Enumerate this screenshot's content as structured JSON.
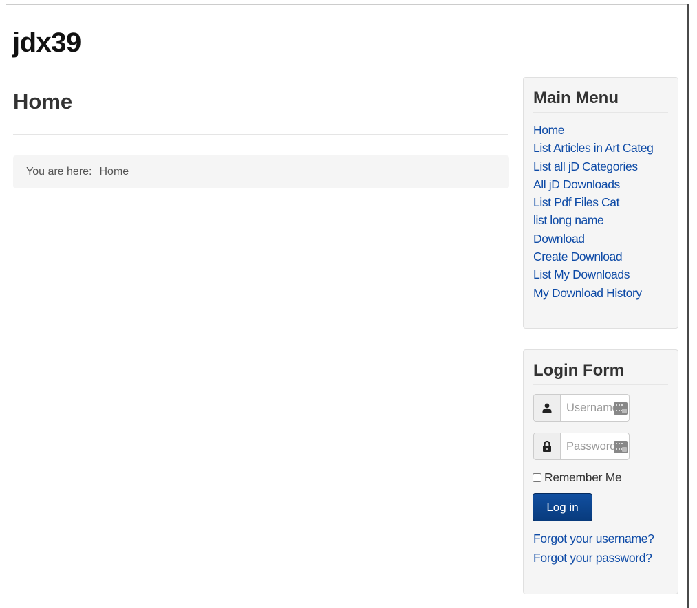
{
  "site": {
    "title": "jdx39"
  },
  "page": {
    "title": "Home"
  },
  "breadcrumb": {
    "prefix": "You are here:",
    "current": "Home"
  },
  "main_menu": {
    "title": "Main Menu",
    "items": [
      {
        "label": "Home"
      },
      {
        "label": "List Articles in Art Categ"
      },
      {
        "label": "List all jD Categories"
      },
      {
        "label": "All jD Downloads"
      },
      {
        "label": "List Pdf Files Cat"
      },
      {
        "label": "list long name"
      },
      {
        "label": "Download"
      },
      {
        "label": "Create Download"
      },
      {
        "label": "List My Downloads"
      },
      {
        "label": "My Download History"
      }
    ]
  },
  "login": {
    "title": "Login Form",
    "username_placeholder": "Username",
    "password_placeholder": "Password",
    "user_icon": "user-icon",
    "lock_icon": "lock-icon",
    "remember_label": "Remember Me",
    "button_label": "Log in",
    "forgot_username": "Forgot your username?",
    "forgot_password": "Forgot your password?"
  },
  "colors": {
    "link": "#0d4aa6",
    "button": "#0a4489",
    "panel": "#f5f5f5"
  }
}
